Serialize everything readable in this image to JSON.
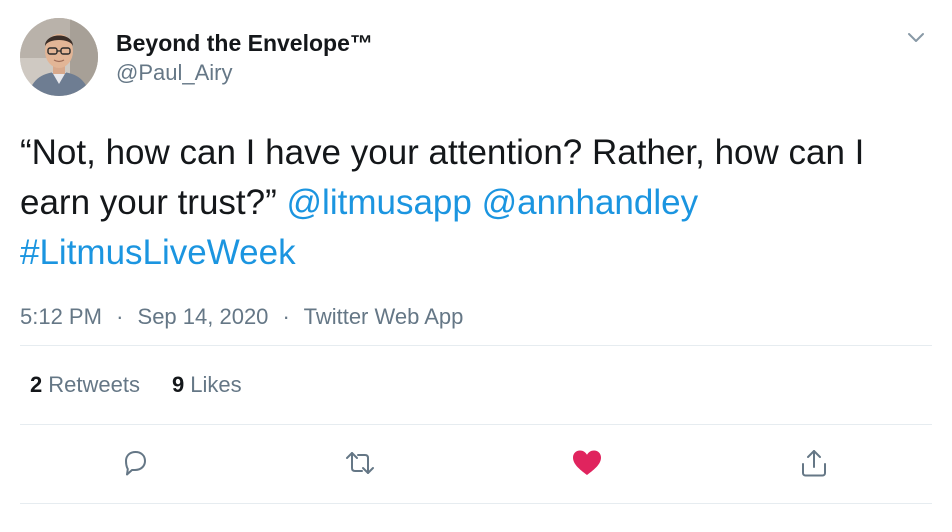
{
  "author": {
    "display_name": "Beyond the Envelope™",
    "handle": "@Paul_Airy",
    "avatar_icon": "user-photo-avatar"
  },
  "tweet": {
    "text_part1": "“Not, how can I have your attention? Rather, how can I earn your trust?”",
    "mention1": "@litmusapp",
    "mention2": "@annhandley",
    "hashtag": "#LitmusLiveWeek",
    "time": "5:12 PM",
    "date": "Sep 14, 2020",
    "source": "Twitter Web App",
    "separator": "·"
  },
  "stats": {
    "retweets_count": "2",
    "retweets_label": "Retweets",
    "likes_count": "9",
    "likes_label": "Likes"
  },
  "actions": {
    "reply_icon": "reply-icon",
    "retweet_icon": "retweet-icon",
    "like_icon": "heart-icon",
    "share_icon": "share-icon"
  },
  "colors": {
    "link": "#1b95e0",
    "secondary_text": "#657786",
    "like_active": "#e0245e",
    "divider": "#e6ecf0"
  }
}
